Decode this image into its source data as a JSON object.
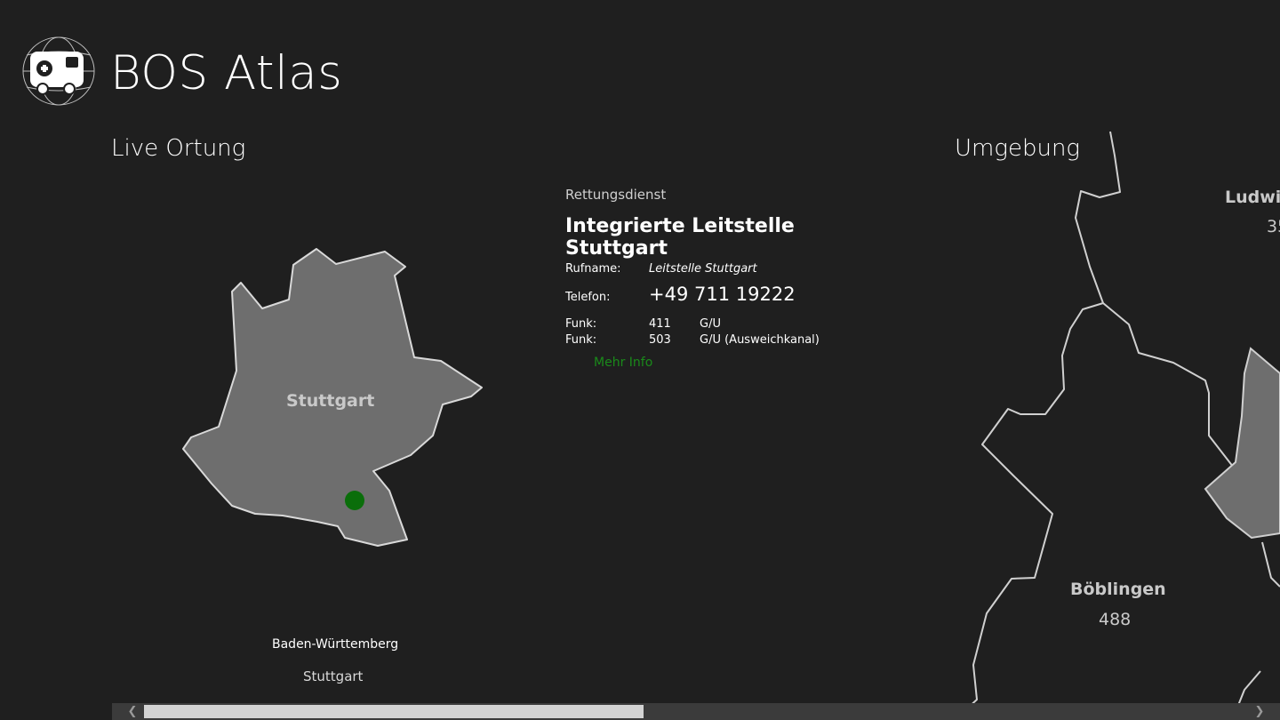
{
  "app": {
    "title": "BOS Atlas",
    "logo_icon": "ambulance-globe-icon"
  },
  "sections": {
    "live": "Live Ortung",
    "umgebung": "Umgebung"
  },
  "live_map": {
    "region": "Stuttgart",
    "marker_color": "#0a6e0a"
  },
  "info": {
    "category": "Rettungsdienst",
    "name": "Integrierte Leitstelle Stuttgart",
    "rufname_label": "Rufname:",
    "rufname": "Leitstelle Stuttgart",
    "telefon_label": "Telefon:",
    "telefon": "+49 711 19222",
    "funk": [
      {
        "label": "Funk:",
        "channel": "411",
        "type": "G/U"
      },
      {
        "label": "Funk:",
        "channel": "503",
        "type": "G/U (Ausweichkanal)"
      }
    ],
    "mehr_info": "Mehr Info"
  },
  "footer": {
    "state": "Baden-Württemberg",
    "city": "Stuttgart"
  },
  "umgebung_map": {
    "regions": [
      {
        "name": "Böblingen",
        "count": "488"
      },
      {
        "name": "Ludwi",
        "count": "35"
      }
    ]
  },
  "scrollbar": {
    "left_icon": "chevron-left-icon",
    "right_icon": "chevron-right-icon"
  },
  "colors": {
    "background": "#1f1f1f",
    "region_fill": "#6e6e6e",
    "accent_green": "#1a8a1a"
  }
}
